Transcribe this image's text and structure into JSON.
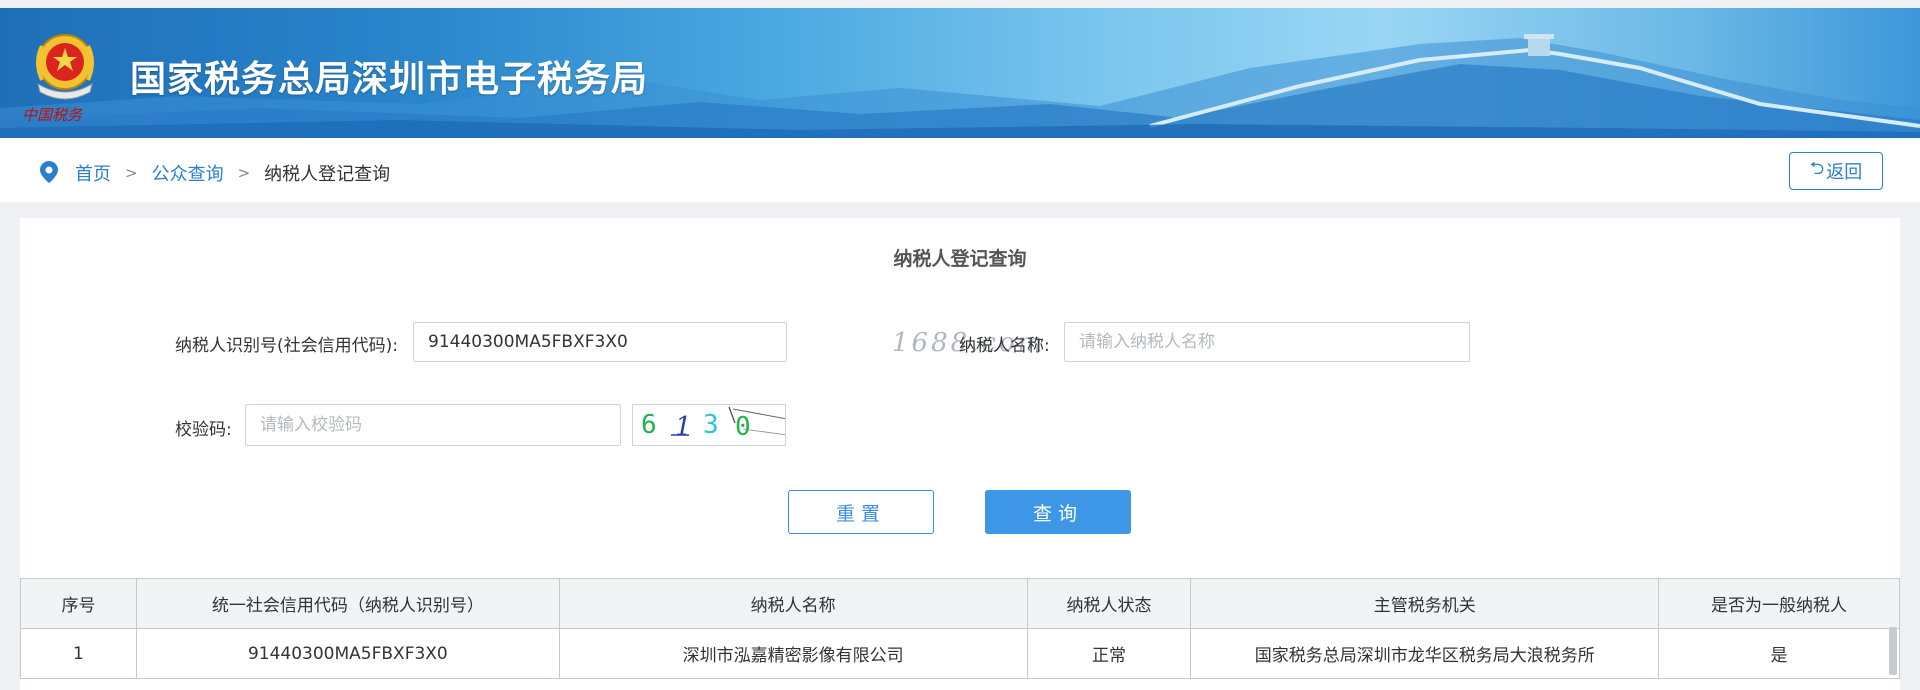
{
  "header": {
    "site_title": "国家税务总局深圳市电子税务局",
    "emblem_caption": "中国税务"
  },
  "breadcrumb": {
    "items": [
      "首页",
      "公众查询",
      "纳税人登记查询"
    ],
    "separator": ">",
    "back_label": "返回"
  },
  "form": {
    "title": "纳税人登记查询",
    "taxpayer_id_label": "纳税人识别号(社会信用代码):",
    "taxpayer_id_value": "91440300MA5FBXF3X0",
    "taxpayer_name_label": "纳税人名称:",
    "taxpayer_name_placeholder": "请输入纳税人名称",
    "verify_label": "校验码:",
    "verify_placeholder": "请输入校验码",
    "captcha_text": "6130",
    "watermark": "1688.com",
    "reset_label": "重置",
    "query_label": "查询"
  },
  "table": {
    "columns": [
      "序号",
      "统一社会信用代码（纳税人识别号）",
      "纳税人名称",
      "纳税人状态",
      "主管税务机关",
      "是否为一般纳税人"
    ],
    "rows": [
      [
        "1",
        "91440300MA5FBXF3X0",
        "深圳市泓嘉精密影像有限公司",
        "正常",
        "国家税务总局深圳市龙华区税务局大浪税务所",
        "是"
      ]
    ]
  },
  "colors": {
    "accent": "#2b7fd0",
    "primary_button": "#3d97e6",
    "banner_dark": "#1f6fb8",
    "banner_light": "#9ad6f4"
  }
}
